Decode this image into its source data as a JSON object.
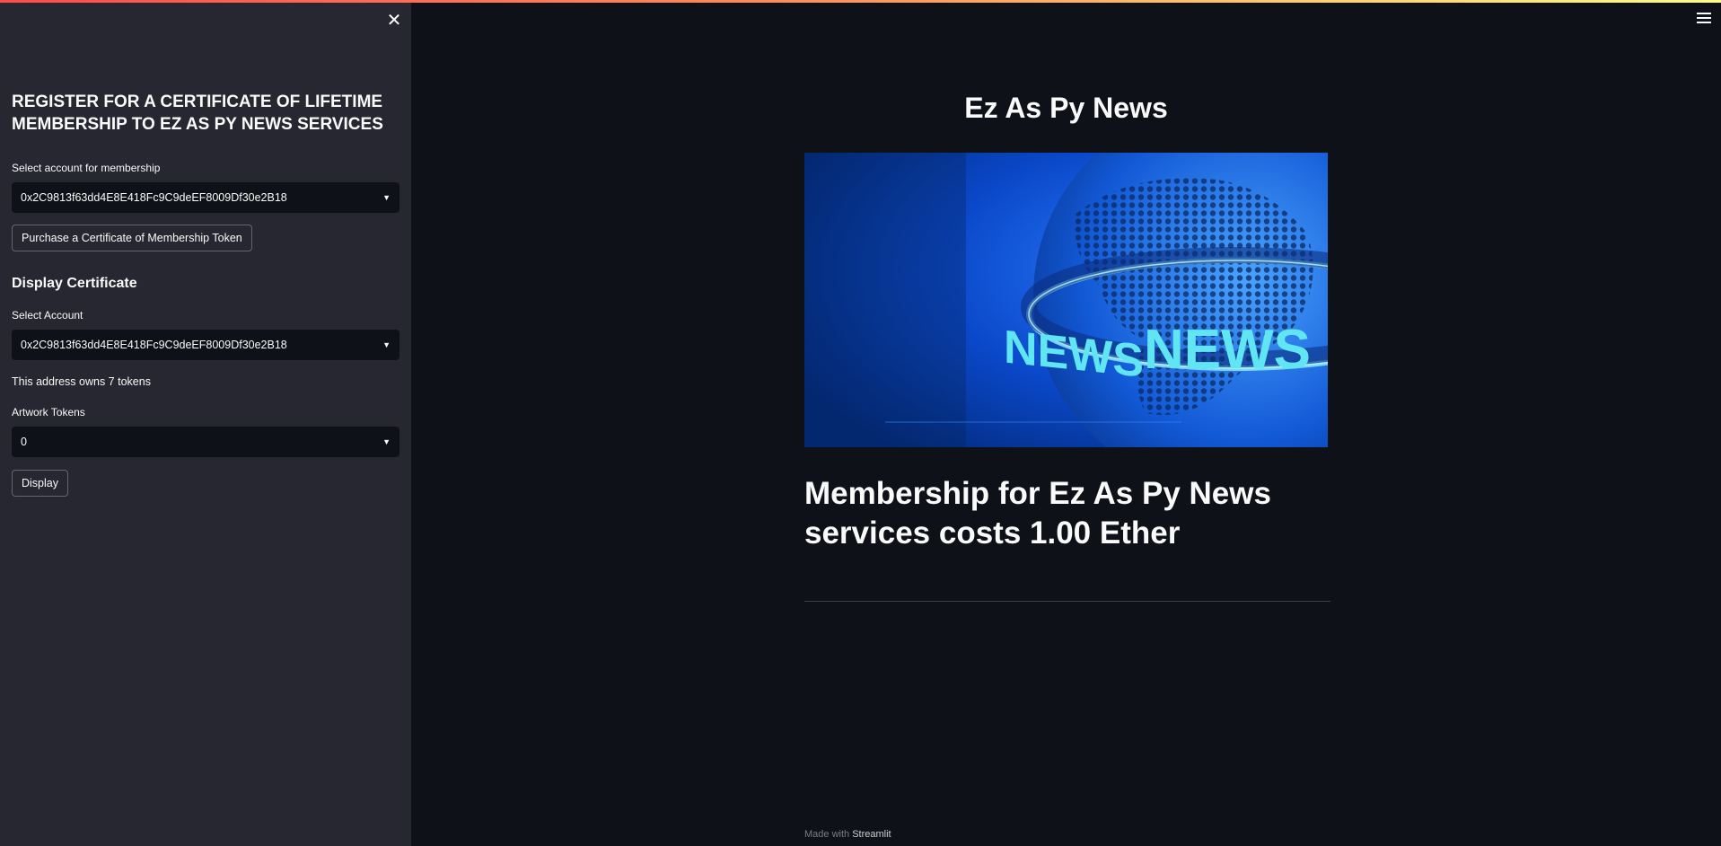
{
  "sidebar": {
    "title": "REGISTER FOR A CERTIFICATE OF LIFETIME MEMBERSHIP TO EZ AS PY NEWS SERVICES",
    "membership_select_label": "Select account for membership",
    "membership_select_value": "0x2C9813f63dd4E8E418Fc9C9deEF8009Df30e2B18",
    "purchase_button_label": "Purchase a Certificate of Membership Token",
    "display_heading": "Display Certificate",
    "account_select_label": "Select Account",
    "account_select_value": "0x2C9813f63dd4E8E418Fc9C9deEF8009Df30e2B18",
    "tokens_owned_text": "This address owns 7 tokens",
    "artwork_select_label": "Artwork Tokens",
    "artwork_select_value": "0",
    "display_button_label": "Display"
  },
  "main": {
    "title": "Ez As Py News",
    "hero_text_left": "NEWS",
    "hero_text_right": "NEWS",
    "membership_text": "Membership for Ez As Py News services costs 1.00 Ether"
  },
  "footer": {
    "prefix": "Made with",
    "brand": "Streamlit"
  },
  "icons": {
    "close": "close-icon",
    "menu": "hamburger-menu-icon",
    "dropdown": "chevron-down-icon"
  },
  "colors": {
    "background": "#0e1117",
    "sidebar": "#262730",
    "text": "#fafafa",
    "accent_gradient_start": "#ff4b4b",
    "accent_gradient_end": "#fffd80"
  }
}
